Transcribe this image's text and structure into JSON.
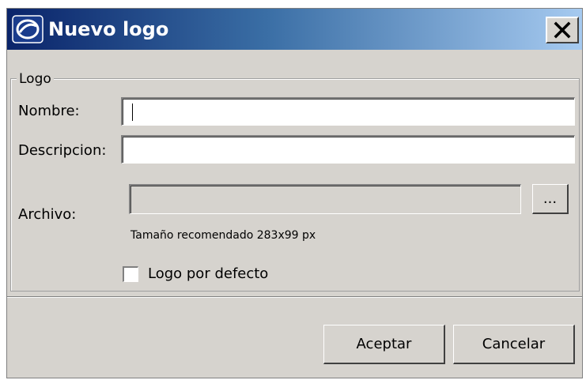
{
  "window": {
    "title": "Nuevo logo",
    "close_label": "✕"
  },
  "group": {
    "legend": "Logo"
  },
  "fields": {
    "nombre_label": "Nombre:",
    "nombre_value": "",
    "descripcion_label": "Descripcion:",
    "descripcion_value": "",
    "archivo_label": "Archivo:",
    "archivo_value": "",
    "browse_label": "...",
    "hint": "Tamaño recomendado 283x99 px"
  },
  "default_checkbox": {
    "label": "Logo por defecto",
    "checked": false
  },
  "buttons": {
    "accept": "Aceptar",
    "cancel": "Cancelar"
  },
  "colors": {
    "title_gradient_start": "#0a246a",
    "title_gradient_end": "#a6caf0",
    "window_bg": "#d6d3ce"
  },
  "icons": {
    "app": "app-logo-icon",
    "close": "close-icon"
  }
}
